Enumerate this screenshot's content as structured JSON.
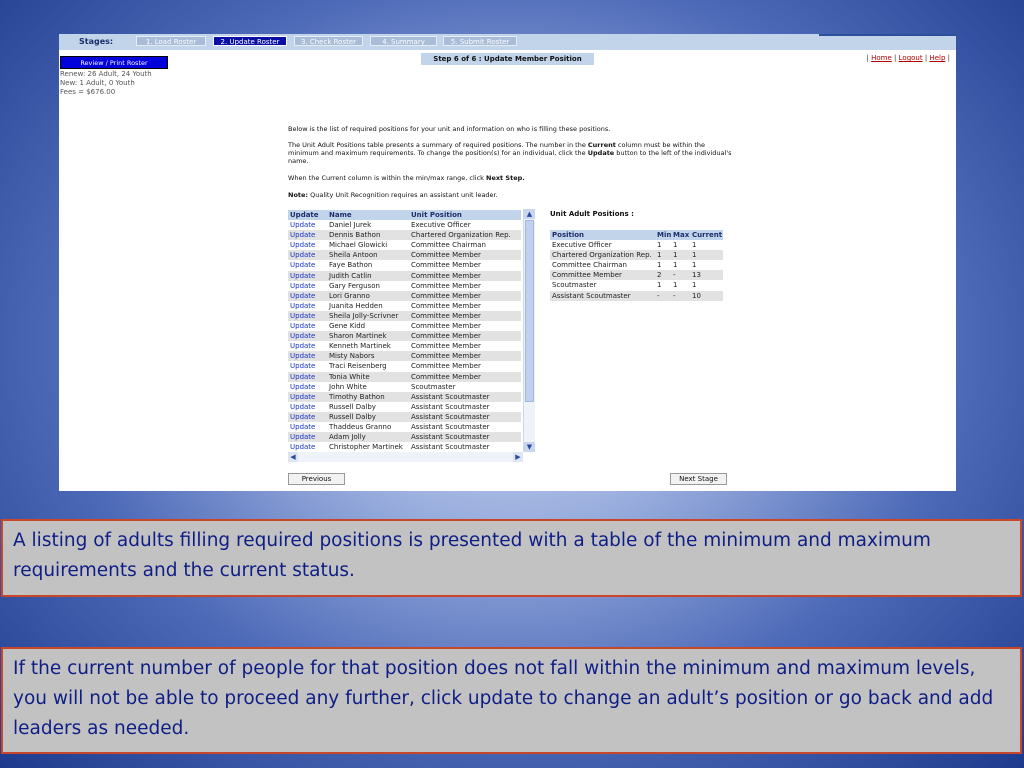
{
  "stage_bar": {
    "label": "Stages:",
    "stages": [
      {
        "label": "1. Load Roster",
        "active": false
      },
      {
        "label": "2. Update Roster",
        "active": true
      },
      {
        "label": "3. Check Roster",
        "active": false
      },
      {
        "label": "4. Summary",
        "active": false
      },
      {
        "label": "5. Submit Roster",
        "active": false
      }
    ]
  },
  "sidebar": {
    "review_button": "Review / Print Roster",
    "renew": "Renew: 26 Adult, 24 Youth",
    "new": "New: 1 Adult, 0 Youth",
    "fees": "Fees = $676.00"
  },
  "step_banner": "Step 6 of 6 : Update Member Position",
  "top_links": {
    "home": "Home",
    "logout": "Logout",
    "help": "Help",
    "sep": "|"
  },
  "instructions": {
    "p1": "Below is the list of required positions for your unit and information on who is filling these positions.",
    "p2_a": "The Unit Adult Positions table presents a summary of required positions. The number in the ",
    "p2_b1": "Current",
    "p2_c": " column must be within the minimum and maximum requirements. To change the position(s) for an individual, click the ",
    "p2_b2": "Update",
    "p2_d": " button to the left of the individual's name.",
    "p3_a": "When the Current column is within the min/max range, click ",
    "p3_b": "Next Step.",
    "p4_a": "Note:",
    "p4_b": " Quality Unit Recognition requires an assistant unit leader."
  },
  "roster": {
    "headers": [
      "Update",
      "Name",
      "Unit Position"
    ],
    "rows": [
      [
        "Update",
        "Daniel Jurek",
        "Executive Officer"
      ],
      [
        "Update",
        "Dennis Bathon",
        "Chartered Organization Rep."
      ],
      [
        "Update",
        "Michael Glowicki",
        "Committee Chairman"
      ],
      [
        "Update",
        "Sheila Antoon",
        "Committee Member"
      ],
      [
        "Update",
        "Faye Bathon",
        "Committee Member"
      ],
      [
        "Update",
        "Judith Catlin",
        "Committee Member"
      ],
      [
        "Update",
        "Gary Ferguson",
        "Committee Member"
      ],
      [
        "Update",
        "Lori Granno",
        "Committee Member"
      ],
      [
        "Update",
        "Juanita Hedden",
        "Committee Member"
      ],
      [
        "Update",
        "Sheila Jolly-Scrivner",
        "Committee Member"
      ],
      [
        "Update",
        "Gene Kidd",
        "Committee Member"
      ],
      [
        "Update",
        "Sharon Martinek",
        "Committee Member"
      ],
      [
        "Update",
        "Kenneth Martinek",
        "Committee Member"
      ],
      [
        "Update",
        "Misty Nabors",
        "Committee Member"
      ],
      [
        "Update",
        "Traci Reisenberg",
        "Committee Member"
      ],
      [
        "Update",
        "Tonia White",
        "Committee Member"
      ],
      [
        "Update",
        "John White",
        "Scoutmaster"
      ],
      [
        "Update",
        "Timothy Bathon",
        "Assistant Scoutmaster"
      ],
      [
        "Update",
        "Russell Dalby",
        "Assistant Scoutmaster"
      ],
      [
        "Update",
        "Russell Dalby",
        "Assistant Scoutmaster"
      ],
      [
        "Update",
        "Thaddeus Granno",
        "Assistant Scoutmaster"
      ],
      [
        "Update",
        "Adam Jolly",
        "Assistant Scoutmaster"
      ],
      [
        "Update",
        "Christopher Martinek",
        "Assistant Scoutmaster"
      ]
    ]
  },
  "positions": {
    "title": "Unit Adult Positions :",
    "headers": [
      "Position",
      "Min",
      "Max",
      "Current"
    ],
    "rows": [
      [
        "Executive Officer",
        "1",
        "1",
        "1"
      ],
      [
        "Chartered Organization Rep.",
        "1",
        "1",
        "1"
      ],
      [
        "Committee Chairman",
        "1",
        "1",
        "1"
      ],
      [
        "Committee Member",
        "2",
        "-",
        "13"
      ],
      [
        "Scoutmaster",
        "1",
        "1",
        "1"
      ],
      [
        "Assistant Scoutmaster",
        "-",
        "-",
        "10"
      ]
    ]
  },
  "nav": {
    "previous": "Previous",
    "next": "Next Stage"
  },
  "captions": {
    "first": "A listing of adults filling required positions is presented with a table of the minimum and maximum requirements and the current status.",
    "second": "If the current number of people for that position does not fall within the minimum and maximum levels, you will not be able to proceed any further, click update to change an adult’s position or go back and add leaders as needed."
  },
  "colors": {
    "caption_text": "#0e1e86",
    "caption_border": "#c9462b",
    "active_stage": "#0b0fa6",
    "link_red": "#b30000"
  }
}
